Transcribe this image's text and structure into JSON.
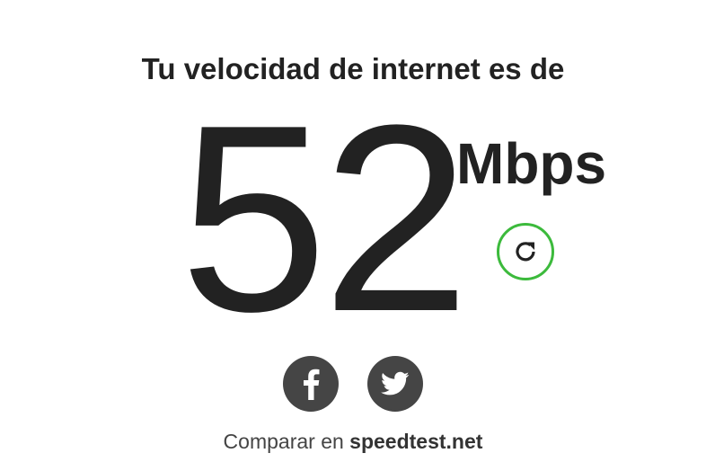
{
  "header": {
    "title": "Tu velocidad de internet es de"
  },
  "result": {
    "speed_value": "52",
    "unit": "Mbps"
  },
  "actions": {
    "refresh_icon": "refresh-icon",
    "facebook_icon": "facebook-icon",
    "twitter_icon": "twitter-icon"
  },
  "footer": {
    "compare_prefix": "Comparar en ",
    "compare_link": "speedtest.net"
  },
  "colors": {
    "text": "#222222",
    "accent_ring": "#3cba3c",
    "social_bg": "#454545"
  }
}
